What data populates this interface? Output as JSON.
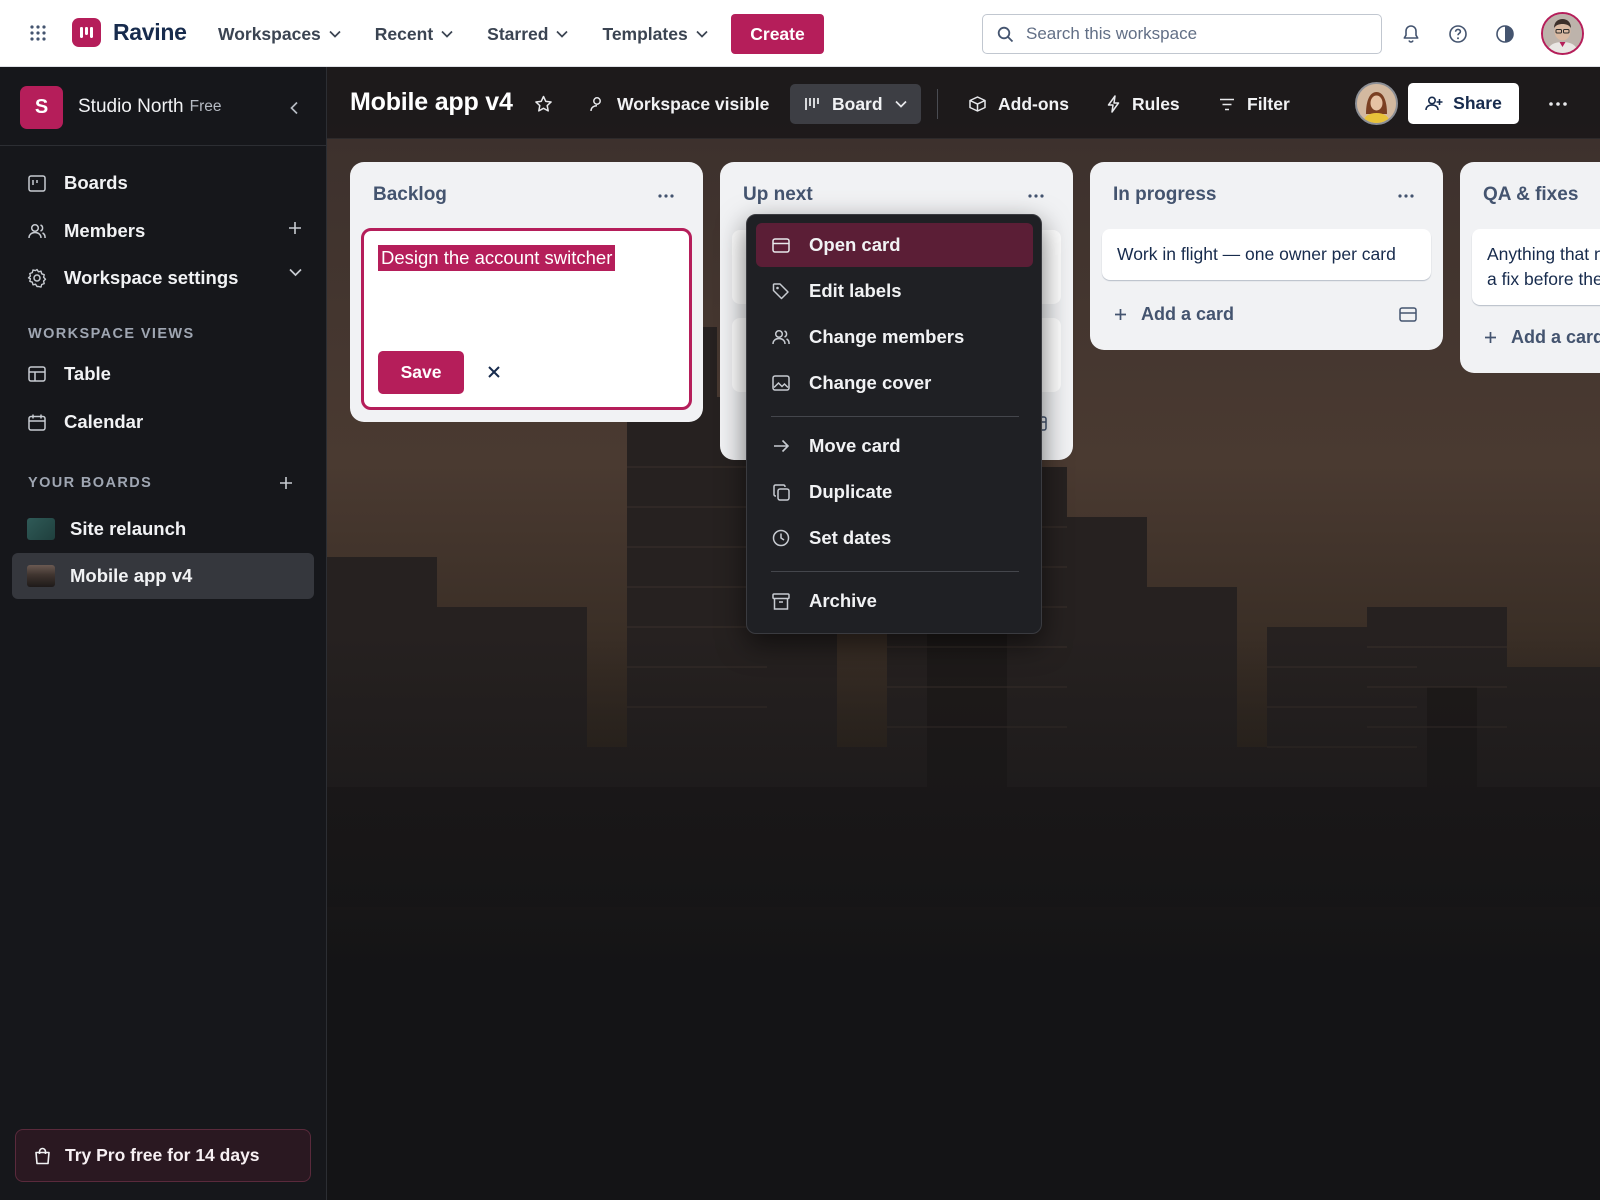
{
  "app": {
    "name": "Ravine",
    "nav": [
      {
        "label": "Workspaces"
      },
      {
        "label": "Recent"
      },
      {
        "label": "Starred"
      },
      {
        "label": "Templates"
      }
    ],
    "create_label": "Create",
    "search_placeholder": "Search this workspace",
    "accent": "#b51e5a"
  },
  "sidebar": {
    "workspace_initial": "S",
    "workspace_name": "Studio North",
    "workspace_plan": "Free",
    "items": [
      {
        "label": "Boards",
        "icon": "board-icon"
      },
      {
        "label": "Members",
        "icon": "members-icon"
      },
      {
        "label": "Workspace settings",
        "icon": "gear-icon"
      }
    ],
    "views_heading": "WORKSPACE VIEWS",
    "views": [
      {
        "label": "Table",
        "icon": "table-icon"
      },
      {
        "label": "Calendar",
        "icon": "calendar-icon"
      }
    ],
    "boards_heading": "YOUR BOARDS",
    "boards": [
      {
        "label": "Site relaunch",
        "color": "#2f5a57"
      },
      {
        "label": "Mobile app v4",
        "color": "#4a3b34"
      }
    ],
    "trial_label": "Try Pro free for 14 days"
  },
  "board": {
    "title": "Mobile app v4",
    "visibility_label": "Workspace visible",
    "view_label": "Board",
    "addons_label": "Add-ons",
    "rules_label": "Rules",
    "filter_label": "Filter",
    "share_label": "Share",
    "lists": [
      {
        "title": "Backlog",
        "composer_value": "Design the account switcher",
        "save_label": "Save"
      },
      {
        "title": "Up next"
      },
      {
        "title": "In progress",
        "card": "Work in flight — one owner per card",
        "add_label": "Add a card"
      },
      {
        "title": "QA & fixes",
        "card": "Anything that needs a fix before the",
        "add_label": "Add a card"
      }
    ]
  },
  "context_menu": {
    "items": [
      {
        "label": "Open card",
        "icon": "card-icon"
      },
      {
        "label": "Edit labels",
        "icon": "tag-icon"
      },
      {
        "label": "Change members",
        "icon": "members-icon"
      },
      {
        "label": "Change cover",
        "icon": "image-icon"
      },
      {
        "label": "Move card",
        "icon": "arrow-right-icon"
      },
      {
        "label": "Duplicate",
        "icon": "copy-icon"
      },
      {
        "label": "Set dates",
        "icon": "clock-icon"
      },
      {
        "label": "Archive",
        "icon": "archive-icon"
      }
    ]
  }
}
